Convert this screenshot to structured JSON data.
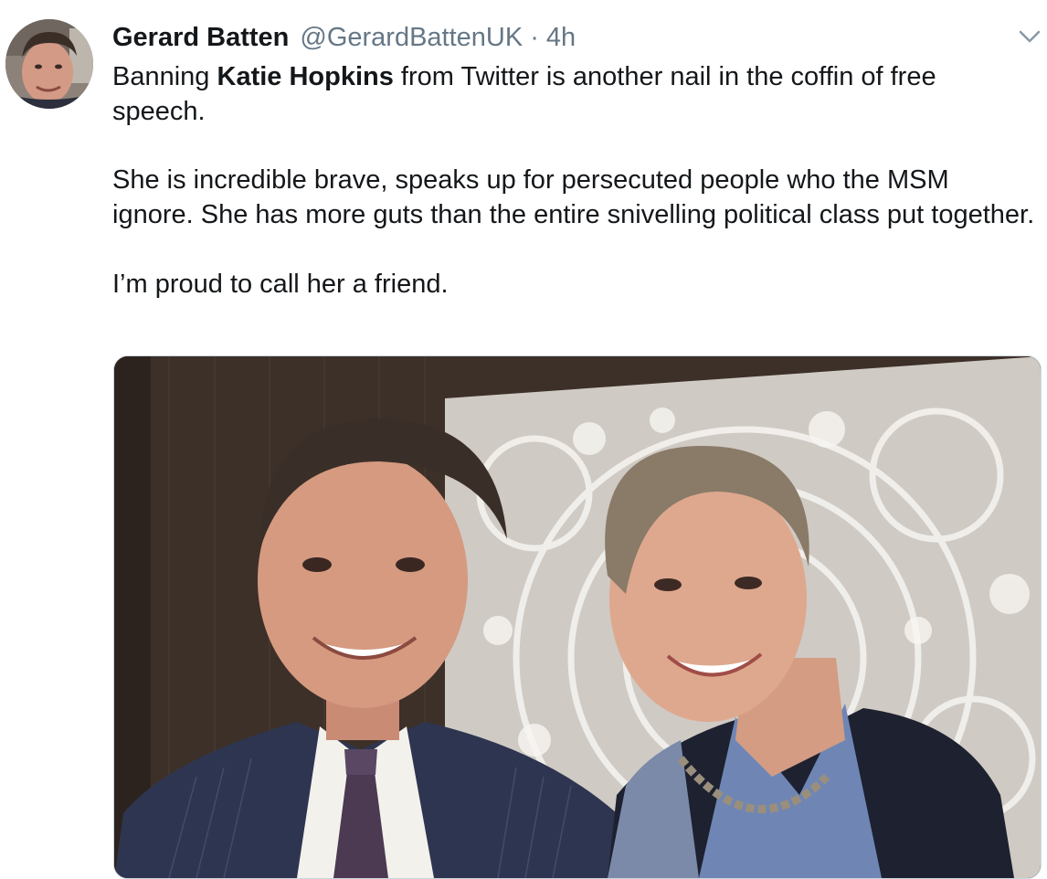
{
  "tweet": {
    "display_name": "Gerard Batten",
    "handle": "@GerardBattenUK",
    "separator": "·",
    "timestamp": "4h",
    "body": {
      "line1_prefix": "Banning ",
      "line1_mention": "Katie Hopkins",
      "line1_suffix": " from Twitter is another nail in the coffin of free speech.",
      "paragraph2": "She is incredible brave, speaks up for persecuted people who the MSM ignore.  She has more guts than the entire snivelling political class put together.",
      "paragraph3": "I’m proud to call her a friend."
    },
    "avatar_icon": "profile-avatar",
    "menu_icon": "chevron-down-icon",
    "photo_description_icon": "tweet-photo"
  },
  "colors": {
    "text_primary": "#14171a",
    "text_secondary": "#657786",
    "border": "#ccd6dd"
  }
}
